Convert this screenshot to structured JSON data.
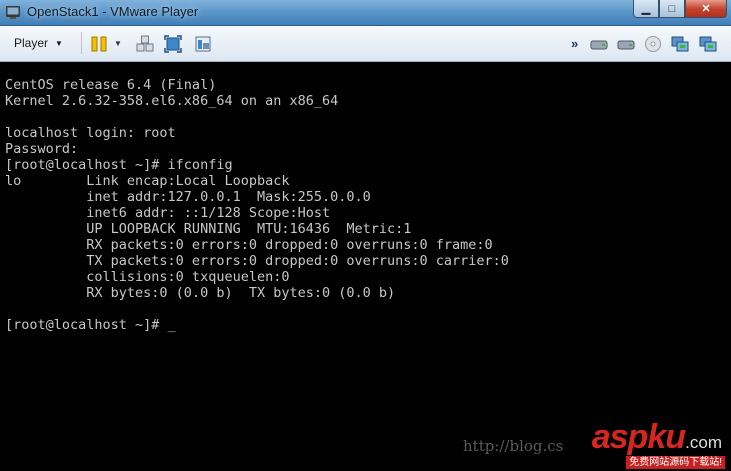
{
  "window": {
    "title": "OpenStack1 - VMware Player",
    "minimize_glyph": "▁",
    "maximize_glyph": "□",
    "close_glyph": "✕"
  },
  "toolbar": {
    "player_label": "Player",
    "icons": [
      "pause-icon",
      "send-ctrl-alt-del-icon",
      "fullscreen-icon",
      "unity-icon",
      "more-icon",
      "hard-disk-icon",
      "hard-disk-2-icon",
      "cd-dvd-icon",
      "network-adapter-icon",
      "network-adapter-2-icon"
    ]
  },
  "console": {
    "lines": [
      "CentOS release 6.4 (Final)",
      "Kernel 2.6.32-358.el6.x86_64 on an x86_64",
      "",
      "localhost login: root",
      "Password:",
      "[root@localhost ~]# ifconfig",
      "lo        Link encap:Local Loopback",
      "          inet addr:127.0.0.1  Mask:255.0.0.0",
      "          inet6 addr: ::1/128 Scope:Host",
      "          UP LOOPBACK RUNNING  MTU:16436  Metric:1",
      "          RX packets:0 errors:0 dropped:0 overruns:0 frame:0",
      "          TX packets:0 errors:0 dropped:0 overruns:0 carrier:0",
      "          collisions:0 txqueuelen:0",
      "          RX bytes:0 (0.0 b)  TX bytes:0 (0.0 b)",
      "",
      "[root@localhost ~]# "
    ],
    "cursor": "_"
  },
  "watermark": {
    "url": "http://blog.cs",
    "brand": "aspku",
    "com": ".com",
    "slogan": "免费网站源码下载站!"
  },
  "colors": {
    "titlebar": "#5d97c8",
    "console_bg": "#000000",
    "console_fg": "#c7c7c7",
    "brand_red": "#d62620"
  }
}
